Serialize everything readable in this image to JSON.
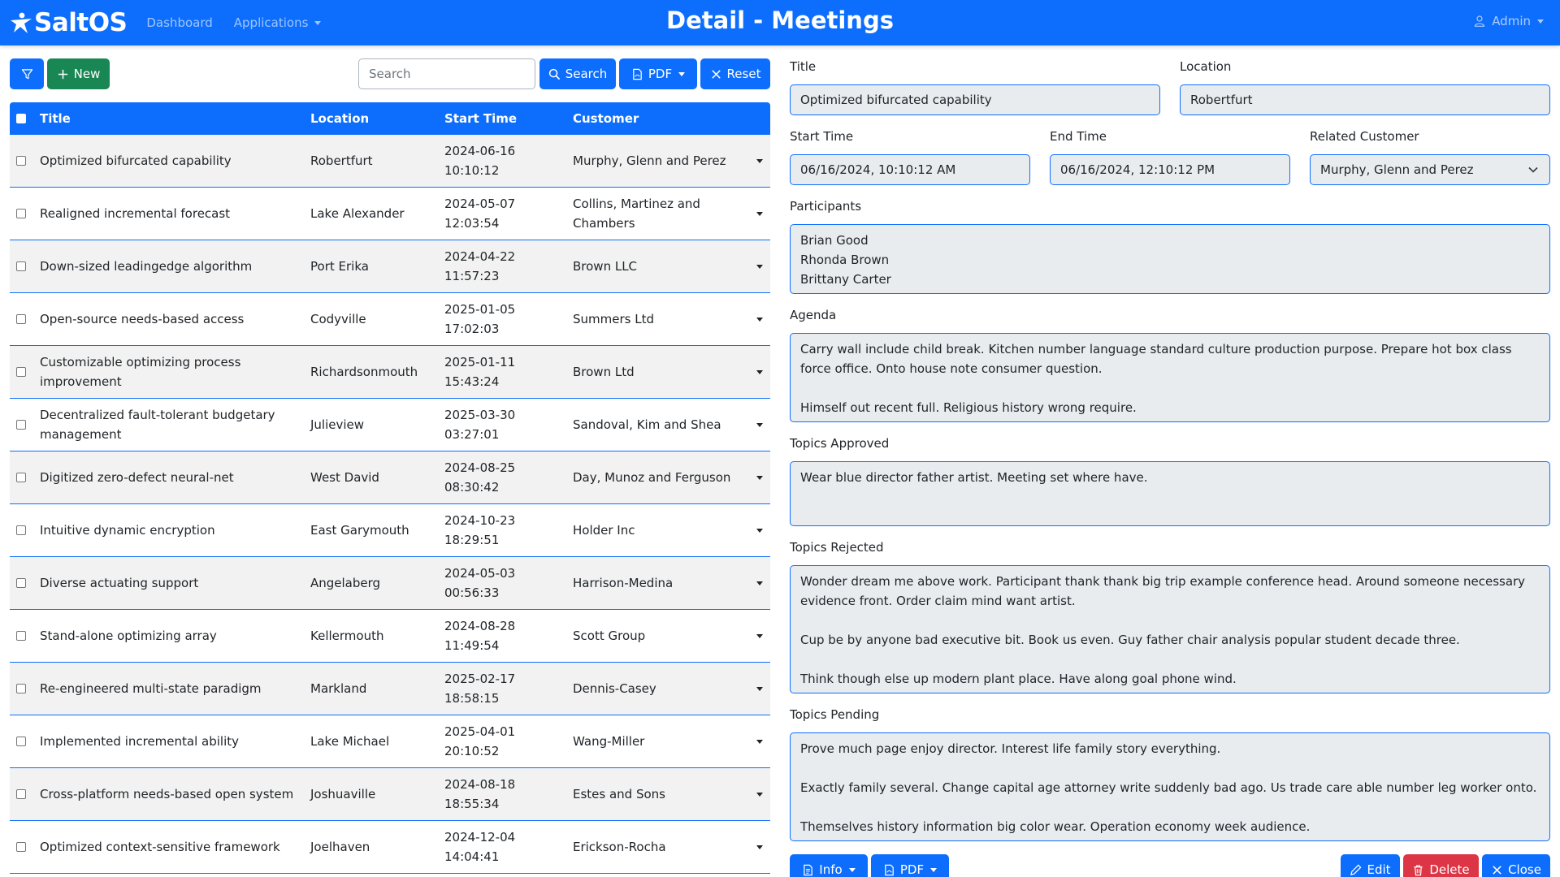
{
  "app": {
    "brand": "SaltOS",
    "page_title": "Detail - Meetings"
  },
  "nav": {
    "dashboard": "Dashboard",
    "applications": "Applications",
    "user": "Admin"
  },
  "toolbar": {
    "new_label": "New",
    "search_placeholder": "Search",
    "search_label": "Search",
    "pdf_label": "PDF",
    "reset_label": "Reset"
  },
  "table": {
    "headers": {
      "title": "Title",
      "location": "Location",
      "start_time": "Start Time",
      "customer": "Customer"
    },
    "rows": [
      {
        "title": "Optimized bifurcated capability",
        "location": "Robertfurt",
        "date": "2024-06-16",
        "time": "10:10:12",
        "customer": "Murphy, Glenn and Perez"
      },
      {
        "title": "Realigned incremental forecast",
        "location": "Lake Alexander",
        "date": "2024-05-07",
        "time": "12:03:54",
        "customer": "Collins, Martinez and Chambers"
      },
      {
        "title": "Down-sized leadingedge algorithm",
        "location": "Port Erika",
        "date": "2024-04-22",
        "time": "11:57:23",
        "customer": "Brown LLC"
      },
      {
        "title": "Open-source needs-based access",
        "location": "Codyville",
        "date": "2025-01-05",
        "time": "17:02:03",
        "customer": "Summers Ltd"
      },
      {
        "title": "Customizable optimizing process improvement",
        "location": "Richardsonmouth",
        "date": "2025-01-11",
        "time": "15:43:24",
        "customer": "Brown Ltd"
      },
      {
        "title": "Decentralized fault-tolerant budgetary management",
        "location": "Julieview",
        "date": "2025-03-30",
        "time": "03:27:01",
        "customer": "Sandoval, Kim and Shea"
      },
      {
        "title": "Digitized zero-defect neural-net",
        "location": "West David",
        "date": "2024-08-25",
        "time": "08:30:42",
        "customer": "Day, Munoz and Ferguson"
      },
      {
        "title": "Intuitive dynamic encryption",
        "location": "East Garymouth",
        "date": "2024-10-23",
        "time": "18:29:51",
        "customer": "Holder Inc"
      },
      {
        "title": "Diverse actuating support",
        "location": "Angelaberg",
        "date": "2024-05-03",
        "time": "00:56:33",
        "customer": "Harrison-Medina"
      },
      {
        "title": "Stand-alone optimizing array",
        "location": "Kellermouth",
        "date": "2024-08-28",
        "time": "11:49:54",
        "customer": "Scott Group"
      },
      {
        "title": "Re-engineered multi-state paradigm",
        "location": "Markland",
        "date": "2025-02-17",
        "time": "18:58:15",
        "customer": "Dennis-Casey"
      },
      {
        "title": "Implemented incremental ability",
        "location": "Lake Michael",
        "date": "2025-04-01",
        "time": "20:10:52",
        "customer": "Wang-Miller"
      },
      {
        "title": "Cross-platform needs-based open system",
        "location": "Joshuaville",
        "date": "2024-08-18",
        "time": "18:55:34",
        "customer": "Estes and Sons"
      },
      {
        "title": "Optimized context-sensitive framework",
        "location": "Joelhaven",
        "date": "2024-12-04",
        "time": "14:04:41",
        "customer": "Erickson-Rocha"
      }
    ]
  },
  "detail": {
    "title_label": "Title",
    "title_value": "Optimized bifurcated capability",
    "location_label": "Location",
    "location_value": "Robertfurt",
    "start_label": "Start Time",
    "start_value": "06/16/2024, 10:10:12 AM",
    "end_label": "End Time",
    "end_value": "06/16/2024, 12:10:12 PM",
    "customer_label": "Related Customer",
    "customer_value": "Murphy, Glenn and Perez",
    "participants_label": "Participants",
    "participants_value": "Brian Good\nRhonda Brown\nBrittany Carter",
    "agenda_label": "Agenda",
    "agenda_value": "Carry wall include child break. Kitchen number language standard culture production purpose. Prepare hot box class force office. Onto house note consumer question.\n\nHimself out recent full. Religious history wrong require.",
    "approved_label": "Topics Approved",
    "approved_value": "Wear blue director father artist. Meeting set where have.",
    "rejected_label": "Topics Rejected",
    "rejected_value": "Wonder dream me above work. Participant thank thank big trip example conference head. Around someone necessary evidence front. Order claim mind want artist.\n\nCup be by anyone bad executive bit. Book us even. Guy father chair analysis popular student decade three.\n\nThink though else up modern plant place. Have along goal phone wind.",
    "pending_label": "Topics Pending",
    "pending_value": "Prove much page enjoy director. Interest life family story everything.\n\nExactly family several. Change capital age attorney write suddenly bad ago. Us trade care able number leg worker onto.\n\nThemselves history information big color wear. Operation economy week audience."
  },
  "footer_buttons": {
    "info": "Info",
    "pdf": "PDF",
    "edit": "Edit",
    "delete": "Delete",
    "close": "Close"
  },
  "colors": {
    "primary": "#0d6efd",
    "success": "#198754",
    "danger": "#dc3545",
    "readonly_bg": "#e9ecef"
  }
}
